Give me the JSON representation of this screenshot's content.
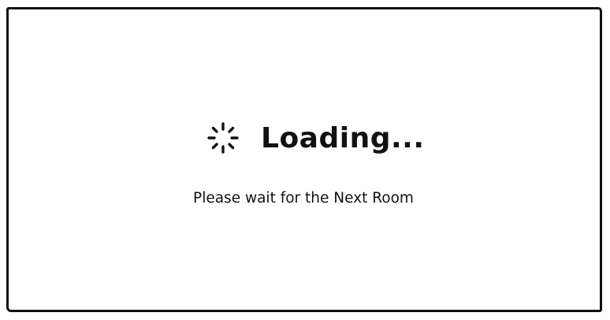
{
  "loading": {
    "title": "Loading...",
    "message": "Please wait for the Next Room",
    "spinner_icon": "spinner-icon"
  },
  "colors": {
    "text": "#111111",
    "background": "#ffffff",
    "border": "#111111"
  }
}
